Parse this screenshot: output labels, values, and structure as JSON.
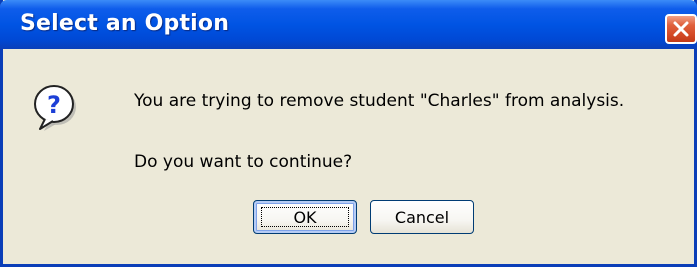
{
  "window": {
    "title": "Select an Option",
    "close_icon": "close-icon"
  },
  "message": {
    "icon": "question-icon",
    "line1": "You are trying to remove student \"Charles\" from analysis.",
    "line2": "Do you want to continue?"
  },
  "buttons": {
    "ok_label": "OK",
    "cancel_label": "Cancel"
  },
  "colors": {
    "titlebar": "#0054E3",
    "dialog_bg": "#ECE9D8",
    "close_button": "#D44A26",
    "icon_blue": "#1C3FD6"
  }
}
